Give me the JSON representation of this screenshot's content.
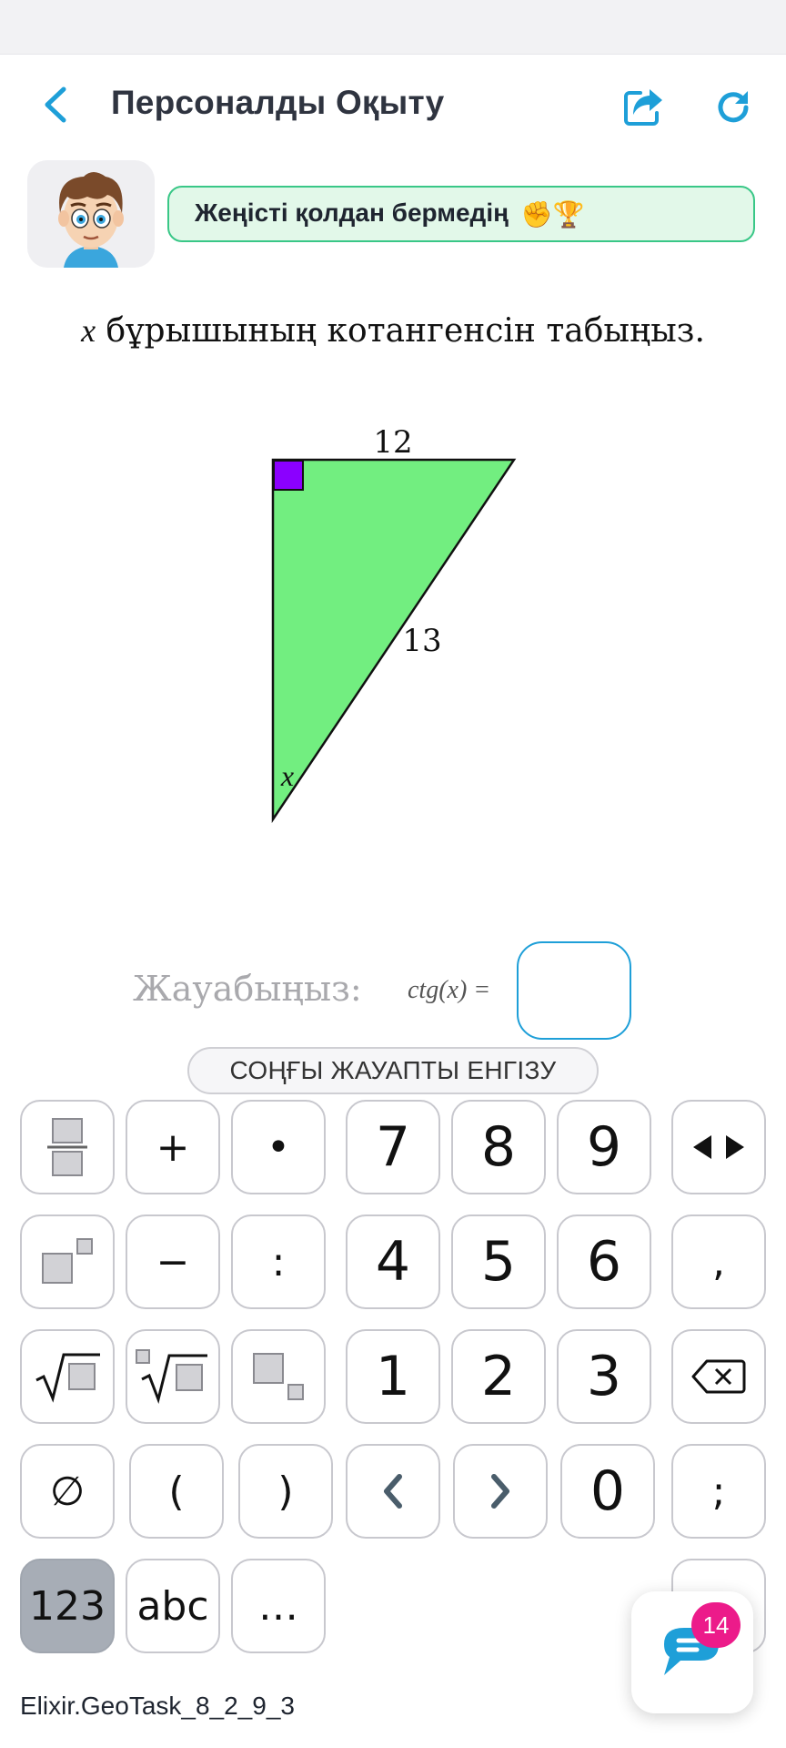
{
  "header": {
    "title": "Персоналды Оқыту"
  },
  "banner": {
    "text": "Жеңісті қолдан бермедің",
    "emoji": "✊🏆"
  },
  "question": {
    "variable": "x",
    "text": "бұрышының котангенсін табыңыз."
  },
  "figure": {
    "top_side_label": "12",
    "hypotenuse_label": "13",
    "angle_label": "x",
    "triangle_fill": "#72ee80",
    "right_angle_fill": "#8b00ff"
  },
  "answer": {
    "label": "Жауабыңыз:",
    "expression": "ctg(x) ="
  },
  "submit_label": "СОҢҒЫ ЖАУАПТЫ ЕНГІЗУ",
  "keyboard": {
    "plus": "+",
    "dot": "•",
    "minus": "−",
    "colon": ":",
    "comma": ",",
    "lparen": "(",
    "rparen": ")",
    "semicolon": ";",
    "empty_set": "∅",
    "digits": [
      "7",
      "8",
      "9",
      "4",
      "5",
      "6",
      "1",
      "2",
      "3",
      "0"
    ],
    "mode_123": "123",
    "mode_abc": "abc",
    "mode_more": "…"
  },
  "chat": {
    "badge_count": "14"
  },
  "footer": {
    "task_id": "Elixir.GeoTask_8_2_9_3"
  },
  "colors": {
    "accent": "#1e9fd8",
    "badge": "#ec1b8a",
    "banner_bg": "#e2f8e9",
    "banner_border": "#39c787"
  }
}
